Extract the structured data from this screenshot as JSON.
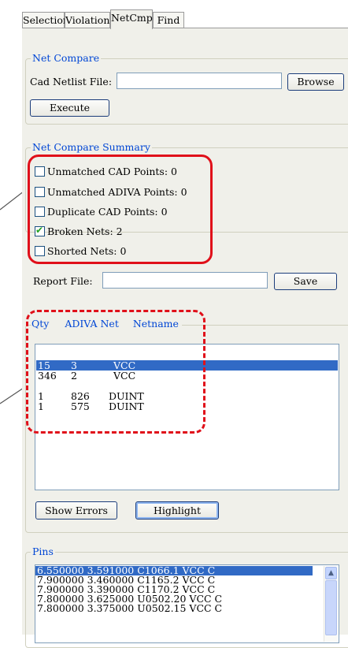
{
  "tabs": [
    {
      "label": "Selection"
    },
    {
      "label": "Violation"
    },
    {
      "label": "NetCmp"
    },
    {
      "label": "Find"
    }
  ],
  "net_compare": {
    "legend": "Net Compare",
    "cad_label": "Cad Netlist File:",
    "cad_value": "",
    "browse": "Browse",
    "execute": "Execute"
  },
  "summary": {
    "legend": "Net Compare Summary",
    "items": [
      {
        "label": "Unmatched CAD Points:",
        "value": "0",
        "checked": false
      },
      {
        "label": "Unmatched ADIVA Points:",
        "value": "0",
        "checked": false
      },
      {
        "label": "Duplicate CAD Points:",
        "value": "0",
        "checked": false
      },
      {
        "label": "Broken Nets:",
        "value": "2",
        "checked": true
      },
      {
        "label": "Shorted Nets:",
        "value": "0",
        "checked": false
      }
    ],
    "report_label": "Report File:",
    "report_value": "",
    "save": "Save"
  },
  "results": {
    "headers": {
      "qty": "Qty",
      "adiva": "ADIVA Net",
      "netname": "Netname"
    },
    "rows": [
      {
        "qty": "15",
        "adiva": "3",
        "netname": "VCC",
        "selected": true
      },
      {
        "qty": "346",
        "adiva": "2",
        "netname": "VCC",
        "selected": false
      },
      {
        "qty": "1",
        "adiva": "826",
        "netname": "DUINT",
        "selected": false
      },
      {
        "qty": "1",
        "adiva": "575",
        "netname": "DUINT",
        "selected": false
      }
    ],
    "show_errors": "Show Errors",
    "highlight": "Highlight"
  },
  "pins": {
    "legend": "Pins",
    "rows": [
      {
        "text": "6.550000 3.591000 C1066.1 VCC C",
        "selected": true
      },
      {
        "text": "7.900000 3.460000 C1165.2 VCC C",
        "selected": false
      },
      {
        "text": "7.900000 3.390000 C1170.2 VCC C",
        "selected": false
      },
      {
        "text": "7.800000 3.625000 U0502.20 VCC C",
        "selected": false
      },
      {
        "text": "7.800000 3.375000 U0502.15 VCC C",
        "selected": false
      }
    ]
  },
  "colors": {
    "accent": "#0046d5",
    "selection": "#316ac5",
    "callout": "#e0101a",
    "panel": "#f0f0ea"
  }
}
